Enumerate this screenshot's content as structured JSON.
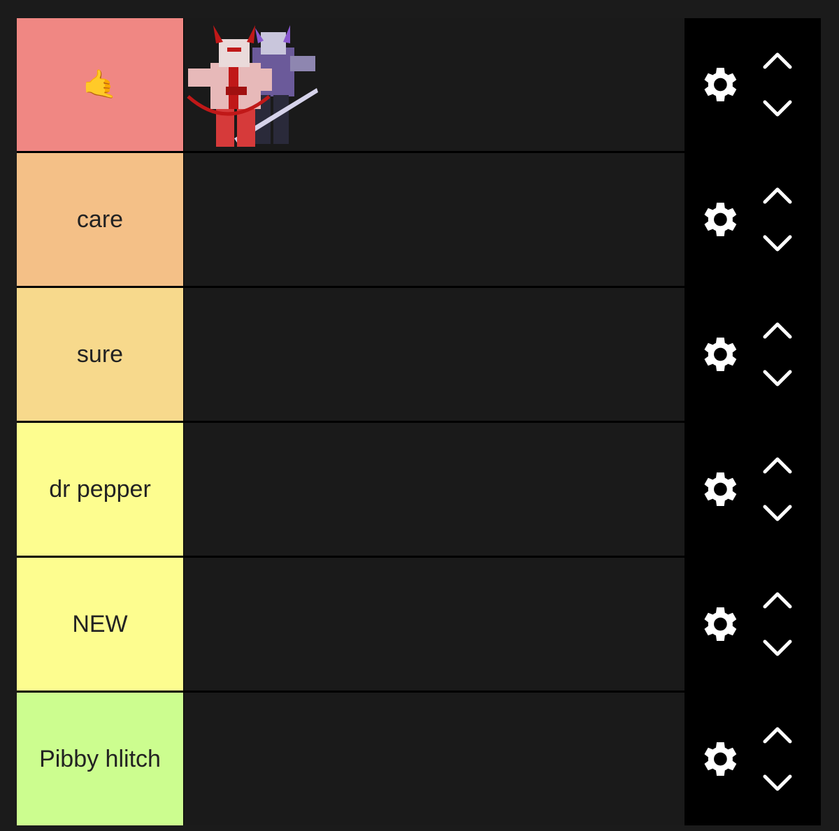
{
  "tiers": [
    {
      "label": "🤙",
      "color": "#f08783",
      "has_item": true
    },
    {
      "label": "care",
      "color": "#f4c087"
    },
    {
      "label": "sure",
      "color": "#f7d98c"
    },
    {
      "label": "dr pepper",
      "color": "#fdfd8f"
    },
    {
      "label": "NEW",
      "color": "#fdfd8f"
    },
    {
      "label": "Pibby hlitch",
      "color": "#ccfd8f"
    }
  ],
  "icons": {
    "settings": "gear-icon",
    "move_up": "chevron-up-icon",
    "move_down": "chevron-down-icon"
  },
  "item": {
    "icon": "character-thumbnail"
  }
}
